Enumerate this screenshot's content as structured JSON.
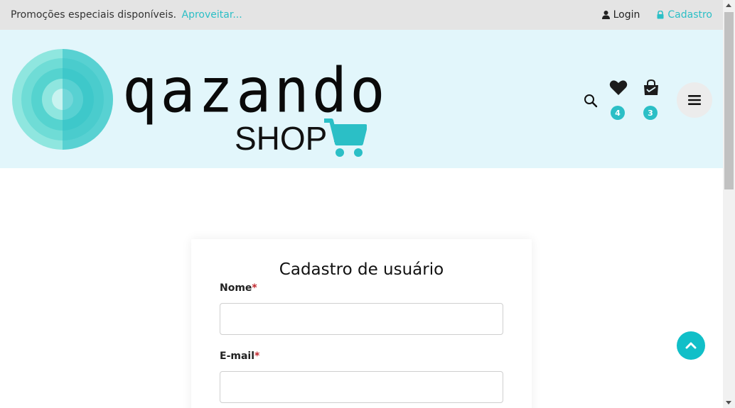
{
  "topbar": {
    "promo_text": "Promoções especiais disponíveis.",
    "promo_link": "Aproveitar...",
    "login_label": "Login",
    "signup_label": "Cadastro"
  },
  "header": {
    "logo_word": "qazando",
    "logo_sub": "SHOP",
    "wishlist_count": "4",
    "cart_count": "3",
    "icons": [
      "search-icon",
      "heart-icon",
      "bag-icon",
      "hamburger-icon"
    ]
  },
  "form": {
    "title": "Cadastro de usuário",
    "name_label": "Nome",
    "email_label": "E-mail",
    "required_mark": "*",
    "name_value": "",
    "email_value": ""
  },
  "colors": {
    "accent": "#2bbfc6",
    "header_bg": "#e2f6fb",
    "topbar_bg": "#e4e4e4",
    "required": "#c1272d"
  }
}
